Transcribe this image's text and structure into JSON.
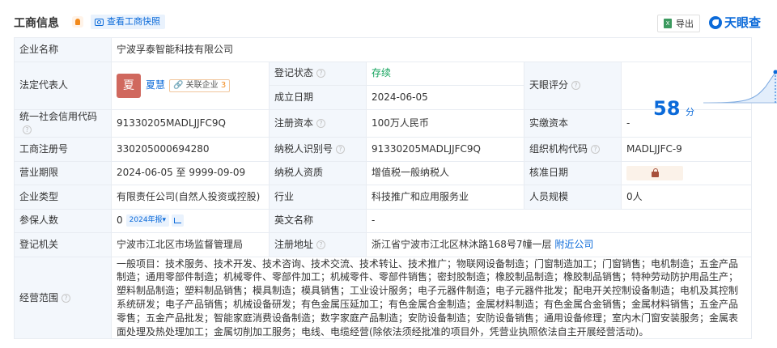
{
  "header": {
    "title": "工商信息",
    "snapshot_label": "查看工商快照",
    "export_label": "导出",
    "export_icon_text": "X",
    "brand": "天眼查"
  },
  "rows": {
    "company_name_label": "企业名称",
    "company_name": "宁波孚泰智能科技有限公司",
    "legal_rep_label": "法定代表人",
    "legal_rep_avatar": "夏",
    "legal_rep_name": "夏慧",
    "related_label": "关联企业",
    "related_count": "3",
    "reg_status_label": "登记状态",
    "reg_status": "存续",
    "established_label": "成立日期",
    "established": "2024-06-05",
    "score_label": "天眼评分",
    "score": "58",
    "score_unit": "分",
    "credit_code_label": "统一社会信用代码",
    "credit_code": "91330205MADLJJFC9Q",
    "reg_capital_label": "注册资本",
    "reg_capital": "100万人民币",
    "paid_capital_label": "实缴资本",
    "paid_capital": "-",
    "biz_reg_no_label": "工商注册号",
    "biz_reg_no": "330205000694280",
    "taxpayer_id_label": "纳税人识别号",
    "taxpayer_id": "91330205MADLJJFC9Q",
    "org_code_label": "组织机构代码",
    "org_code": "MADLJJFC-9",
    "term_label": "营业期限",
    "term": "2024-06-05 至 9999-09-09",
    "taxpayer_qual_label": "纳税人资质",
    "taxpayer_qual": "增值税一般纳税人",
    "approval_date_label": "核准日期",
    "company_type_label": "企业类型",
    "company_type": "有限责任公司(自然人投资或控股)",
    "industry_label": "行业",
    "industry": "科技推广和应用服务业",
    "staff_size_label": "人员规模",
    "staff_size": "0人",
    "insured_label": "参保人数",
    "insured": "0",
    "annual_report_label": "2024年报",
    "english_name_label": "英文名称",
    "english_name": "-",
    "authority_label": "登记机关",
    "authority": "宁波市江北区市场监督管理局",
    "address_label": "注册地址",
    "address": "浙江省宁波市江北区林沐路168号7幢一层",
    "nearby_label": "附近公司",
    "scope_label": "经营范围",
    "scope": "一般项目：技术服务、技术开发、技术咨询、技术交流、技术转让、技术推广；物联网设备制造；门窗制造加工；门窗销售；电机制造；五金产品制造；通用零部件制造；机械零件、零部件加工；机械零件、零部件销售；密封胶制造；橡胶制品制造；橡胶制品销售；特种劳动防护用品生产；塑料制品制造；塑料制品销售；模具制造；模具销售；工业设计服务；电子元器件制造；电子元器件批发；配电开关控制设备制造；电机及其控制系统研发；电子产品销售；机械设备研发；有色金属压延加工；有色金属合金制造；金属材料制造；有色金属合金销售；金属材料销售；五金产品零售；五金产品批发；智能家庭消费设备制造；数字家庭产品制造；安防设备制造；安防设备销售；通用设备修理；室内木门窗安装服务；金属表面处理及热处理加工；金属切削加工服务；电线、电缆经营(除依法须经批准的项目外，凭营业执照依法自主开展经营活动)。"
  },
  "colors": {
    "label_bg": "#f3f7fc",
    "border": "#e8ecf2",
    "link": "#0b6ad9",
    "status_green": "#13a35c",
    "avatar_bg": "#d0685e"
  }
}
